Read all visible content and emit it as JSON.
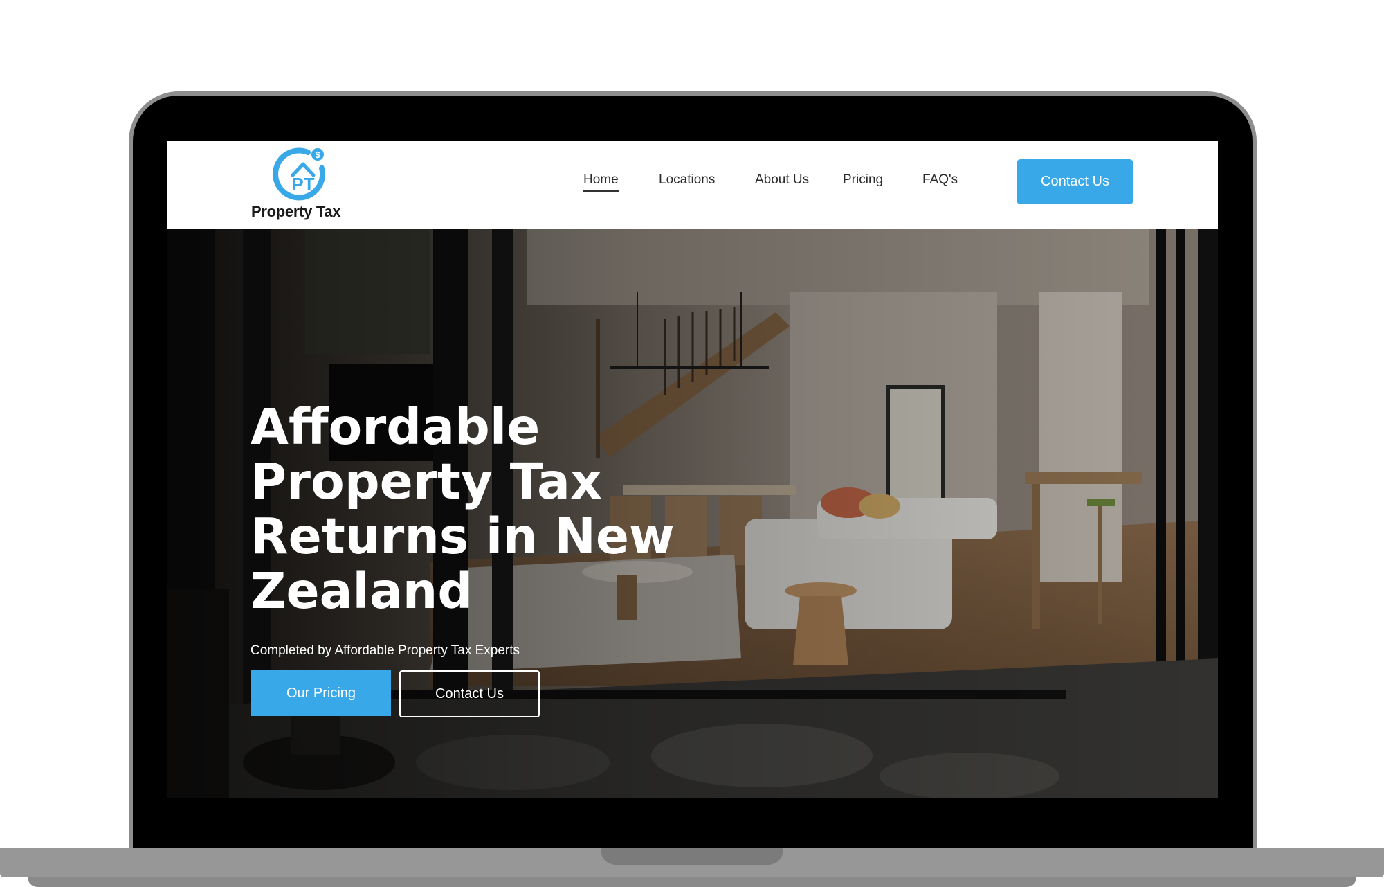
{
  "brand": {
    "name": "Property Tax",
    "mark_letters": "PT",
    "badge_symbol": "$",
    "accent_color": "#38a8e8"
  },
  "nav": {
    "links": [
      {
        "label": "Home",
        "active": true
      },
      {
        "label": "Locations"
      },
      {
        "label": "About Us"
      },
      {
        "label": "Pricing"
      },
      {
        "label": "FAQ's"
      }
    ],
    "cta_label": "Contact Us"
  },
  "hero": {
    "title": "Affordable Property Tax Returns in New Zealand",
    "subtitle": "Completed by Affordable Property Tax Experts",
    "primary_button": "Our Pricing",
    "secondary_button": "Contact Us"
  }
}
